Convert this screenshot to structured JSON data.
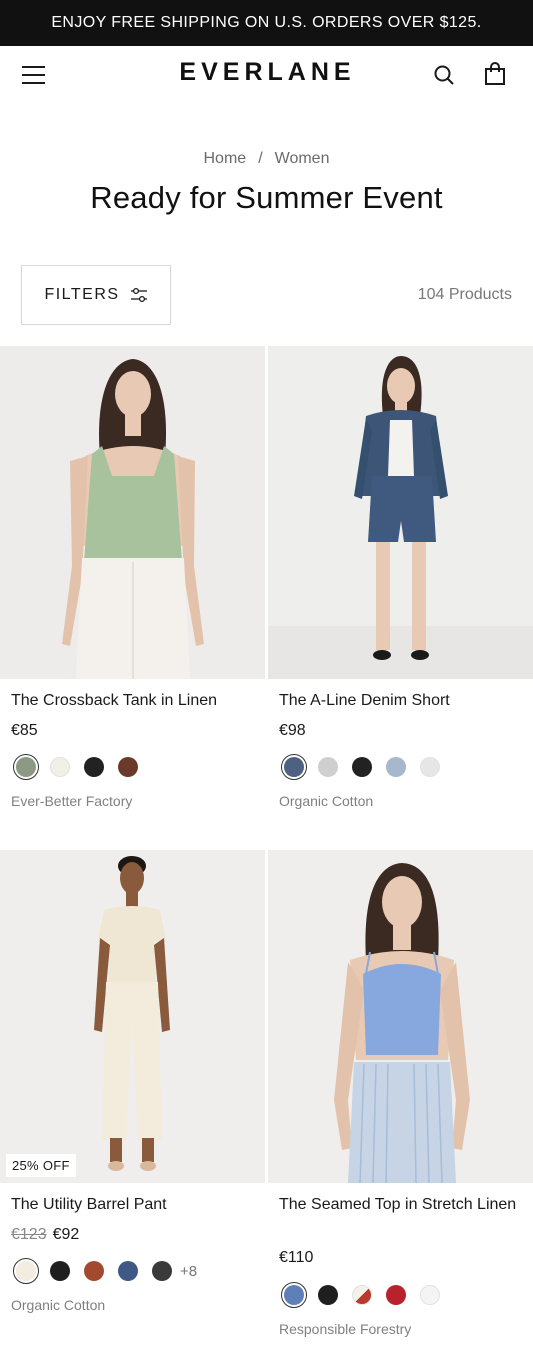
{
  "promo": {
    "text": "ENJOY FREE SHIPPING ON U.S. ORDERS OVER $125."
  },
  "header": {
    "logo": "EVERLANE"
  },
  "breadcrumb": {
    "home": "Home",
    "separator": "/",
    "current": "Women"
  },
  "page_title": "Ready for Summer Event",
  "toolbar": {
    "filters_label": "FILTERS",
    "product_count": "104 Products"
  },
  "products": [
    {
      "name": "The Crossback Tank in Linen",
      "price": "€85",
      "old_price": "",
      "badge": "",
      "tag": "Ever-Better Factory",
      "swatches": [
        "#8c9a85",
        "#f2efe6",
        "#222222",
        "#6b3a2a"
      ],
      "more_colors": "",
      "image": {
        "bg": "#eeeceb",
        "top": "#a7c29c",
        "bottom": "#f4f1ec"
      }
    },
    {
      "name": "The A-Line Denim Short",
      "price": "€98",
      "old_price": "",
      "badge": "",
      "tag": "Organic Cotton",
      "swatches": [
        "#4f6182",
        "#cfcfcf",
        "#222222",
        "#a7b7cc",
        "#e6e6e6"
      ],
      "more_colors": "",
      "image": {
        "bg": "#eeeeed",
        "top": "#3d5677",
        "bottom": "#3f5a7e"
      }
    },
    {
      "name": "The Utility Barrel Pant",
      "price": "€92",
      "old_price": "€123",
      "badge": "25% OFF",
      "tag": "Organic Cotton",
      "swatches": [
        "#f3ece0",
        "#1f1f1f",
        "#a14a2e",
        "#3f5886",
        "#3a3a3a"
      ],
      "more_colors": "+8",
      "image": {
        "bg": "#efeeec",
        "top": "#f0e6d4",
        "bottom": "#f3ebdc"
      }
    },
    {
      "name": "The Seamed Top in Stretch Linen",
      "price": "€110",
      "old_price": "",
      "badge": "",
      "tag": "Responsible Forestry",
      "swatches": [
        "#5e7fb8",
        "#1f1f1f",
        "#b63a2d",
        "#b8232b",
        "#f4f4f4"
      ],
      "more_colors": "",
      "image": {
        "bg": "#efeeec",
        "top": "#86a8df",
        "bottom": "#c6d4e6"
      }
    }
  ]
}
